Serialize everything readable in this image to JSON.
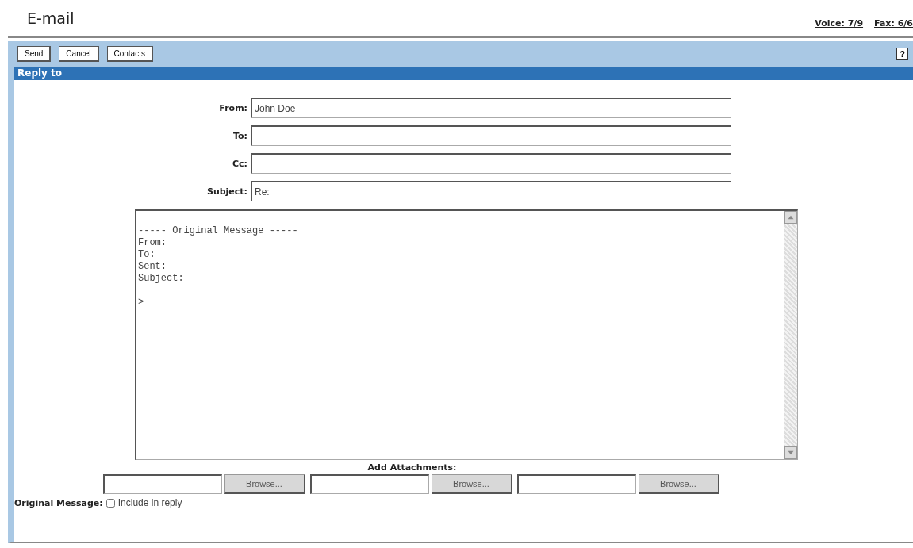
{
  "page_title": "E-mail",
  "header_links": [
    {
      "label": "Voice: 7/9"
    },
    {
      "label": "Fax: 6/6"
    }
  ],
  "toolbar": {
    "buttons": [
      "Send",
      "Cancel",
      "Contacts"
    ],
    "help": "?"
  },
  "section_title": "Reply to",
  "fields": [
    {
      "label": "From:",
      "value": "John Doe"
    },
    {
      "label": "To:"
    },
    {
      "label": "Cc:"
    },
    {
      "label": "Subject:",
      "value": "Re:"
    }
  ],
  "message": "----- Original Message -----\nFrom:\nTo:\nSent:\nSubject:\n\n>",
  "attachments": {
    "label": "Add Attachments:",
    "browse_buttons": [
      "Browse...",
      "Browse...",
      "Browse..."
    ]
  },
  "original_message": {
    "label": "Original Message:",
    "option": "Include in reply",
    "checked": false
  }
}
